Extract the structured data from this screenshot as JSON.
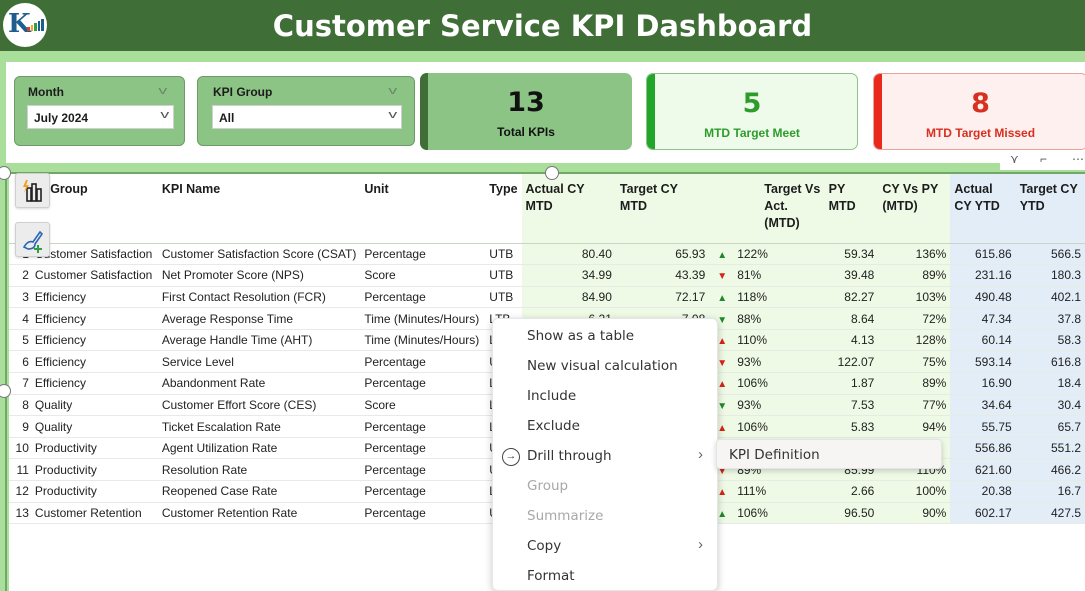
{
  "header": {
    "title": "Customer Service KPI Dashboard",
    "logo_text": "K",
    "logo_colors": {
      "primary": "#1d5e8e",
      "bars": [
        "#e43d30",
        "#f5a623",
        "#2f9e44",
        "#1d5e8e",
        "#1d5e8e"
      ]
    }
  },
  "theme": {
    "header_bg": "#3f6e37",
    "band_bg": "#a9df9b",
    "accent_green": "#22a52a",
    "accent_red": "#e8291b"
  },
  "slicers": [
    {
      "label": "Month",
      "value": "July 2024"
    },
    {
      "label": "KPI Group",
      "value": "All"
    }
  ],
  "cards": {
    "total": {
      "value": "13",
      "caption": "Total KPIs"
    },
    "meet": {
      "value": "5",
      "caption": "MTD Target Meet"
    },
    "missed": {
      "value": "8",
      "caption": "MTD Target Missed"
    }
  },
  "visual_header_icons": [
    "filter-icon",
    "focus-mode-icon",
    "more-options-icon"
  ],
  "table": {
    "columns": [
      "KPI Group",
      "KPI Name",
      "Unit",
      "Type",
      "Actual CY MTD",
      "Target CY MTD",
      "Target Vs Act. (MTD)",
      "PY MTD",
      "CY Vs PY (MTD)",
      "Actual CY YTD",
      "Target CY YTD"
    ],
    "column_display": {
      "kpi_group": "PI Group",
      "actual_cy_mtd": "Actual CY MTD",
      "target_cy_mtd": "Target CY MTD",
      "target_vs_act": "Target Vs Act. (MTD)",
      "py_mtd": "PY MTD",
      "cy_vs_py": "CY Vs PY (MTD)",
      "actual_cy_ytd": "Actual CY YTD",
      "target_cy_ytd": "Target CY YTD"
    },
    "rows": [
      {
        "idx": "1",
        "group": "Customer Satisfaction",
        "name": "Customer Satisfaction Score (CSAT)",
        "unit": "Percentage",
        "type": "UTB",
        "actual_mtd": "80.40",
        "target_mtd": "65.93",
        "arrow": "up-green",
        "tva": "122%",
        "py_mtd": "59.34",
        "cy_vs_py": "136%",
        "actual_ytd": "615.86",
        "target_ytd": "566.5"
      },
      {
        "idx": "2",
        "group": "Customer Satisfaction",
        "name": "Net Promoter Score (NPS)",
        "unit": "Score",
        "type": "UTB",
        "actual_mtd": "34.99",
        "target_mtd": "43.39",
        "arrow": "down-red",
        "tva": "81%",
        "py_mtd": "39.48",
        "cy_vs_py": "89%",
        "actual_ytd": "231.16",
        "target_ytd": "180.3"
      },
      {
        "idx": "3",
        "group": "Efficiency",
        "name": "First Contact Resolution (FCR)",
        "unit": "Percentage",
        "type": "UTB",
        "actual_mtd": "84.90",
        "target_mtd": "72.17",
        "arrow": "up-green",
        "tva": "118%",
        "py_mtd": "82.27",
        "cy_vs_py": "103%",
        "actual_ytd": "490.48",
        "target_ytd": "402.1"
      },
      {
        "idx": "4",
        "group": "Efficiency",
        "name": "Average Response Time",
        "unit": "Time (Minutes/Hours)",
        "type": "LTB",
        "actual_mtd": "6.21",
        "target_mtd": "7.08",
        "arrow": "down-green",
        "tva": "88%",
        "py_mtd": "8.64",
        "cy_vs_py": "72%",
        "actual_ytd": "47.34",
        "target_ytd": "37.8"
      },
      {
        "idx": "5",
        "group": "Efficiency",
        "name": "Average Handle Time (AHT)",
        "unit": "Time (Minutes/Hours)",
        "type": "LTB",
        "actual_mtd": "",
        "target_mtd": "",
        "arrow": "up-red",
        "tva": "110%",
        "py_mtd": "4.13",
        "cy_vs_py": "128%",
        "actual_ytd": "60.14",
        "target_ytd": "58.3"
      },
      {
        "idx": "6",
        "group": "Efficiency",
        "name": "Service Level",
        "unit": "Percentage",
        "type": "UTB",
        "actual_mtd": "",
        "target_mtd": "",
        "arrow": "down-red",
        "tva": "93%",
        "py_mtd": "122.07",
        "cy_vs_py": "75%",
        "actual_ytd": "593.14",
        "target_ytd": "616.8"
      },
      {
        "idx": "7",
        "group": "Efficiency",
        "name": "Abandonment Rate",
        "unit": "Percentage",
        "type": "LTB",
        "actual_mtd": "",
        "target_mtd": "",
        "arrow": "up-red",
        "tva": "106%",
        "py_mtd": "1.87",
        "cy_vs_py": "89%",
        "actual_ytd": "16.90",
        "target_ytd": "18.4"
      },
      {
        "idx": "8",
        "group": "Quality",
        "name": "Customer Effort Score (CES)",
        "unit": "Score",
        "type": "LTB",
        "actual_mtd": "",
        "target_mtd": "",
        "arrow": "down-green",
        "tva": "93%",
        "py_mtd": "7.53",
        "cy_vs_py": "77%",
        "actual_ytd": "34.64",
        "target_ytd": "30.4"
      },
      {
        "idx": "9",
        "group": "Quality",
        "name": "Ticket Escalation Rate",
        "unit": "Percentage",
        "type": "LTB",
        "actual_mtd": "",
        "target_mtd": "",
        "arrow": "up-red",
        "tva": "106%",
        "py_mtd": "5.83",
        "cy_vs_py": "94%",
        "actual_ytd": "55.75",
        "target_ytd": "65.7"
      },
      {
        "idx": "10",
        "group": "Productivity",
        "name": "Agent Utilization Rate",
        "unit": "Percentage",
        "type": "UTB",
        "actual_mtd": "",
        "target_mtd": "",
        "arrow": "",
        "tva": "",
        "py_mtd": "",
        "cy_vs_py": "",
        "actual_ytd": "556.86",
        "target_ytd": "551.2"
      },
      {
        "idx": "11",
        "group": "Productivity",
        "name": "Resolution Rate",
        "unit": "Percentage",
        "type": "UTB",
        "actual_mtd": "",
        "target_mtd": "",
        "arrow": "down-red",
        "tva": "89%",
        "py_mtd": "85.99",
        "cy_vs_py": "110%",
        "actual_ytd": "621.60",
        "target_ytd": "466.2"
      },
      {
        "idx": "12",
        "group": "Productivity",
        "name": "Reopened Case Rate",
        "unit": "Percentage",
        "type": "LTB",
        "actual_mtd": "",
        "target_mtd": "",
        "arrow": "up-red",
        "tva": "111%",
        "py_mtd": "2.66",
        "cy_vs_py": "100%",
        "actual_ytd": "20.38",
        "target_ytd": "16.7"
      },
      {
        "idx": "13",
        "group": "Customer Retention",
        "name": "Customer Retention Rate",
        "unit": "Percentage",
        "type": "UTB",
        "actual_mtd": "",
        "target_mtd": "",
        "arrow": "up-green",
        "tva": "106%",
        "py_mtd": "96.50",
        "cy_vs_py": "90%",
        "actual_ytd": "602.17",
        "target_ytd": "427.5"
      }
    ]
  },
  "tools": [
    "quick-insights-icon",
    "format-painter-add-icon"
  ],
  "context_menu": {
    "items": [
      {
        "label": "Show as a table",
        "disabled": false,
        "submenu": false
      },
      {
        "label": "New visual calculation",
        "disabled": false,
        "submenu": false
      },
      {
        "label": "Include",
        "disabled": false,
        "submenu": false
      },
      {
        "label": "Exclude",
        "disabled": false,
        "submenu": false
      },
      {
        "label": "Drill through",
        "disabled": false,
        "submenu": true,
        "icon": "drill-through-icon"
      },
      {
        "label": "Group",
        "disabled": true,
        "submenu": false
      },
      {
        "label": "Summarize",
        "disabled": true,
        "submenu": false
      },
      {
        "label": "Copy",
        "disabled": false,
        "submenu": true
      },
      {
        "label": "Format",
        "disabled": false,
        "submenu": false
      }
    ],
    "submenu_items": [
      {
        "label": "KPI Definition"
      }
    ]
  }
}
